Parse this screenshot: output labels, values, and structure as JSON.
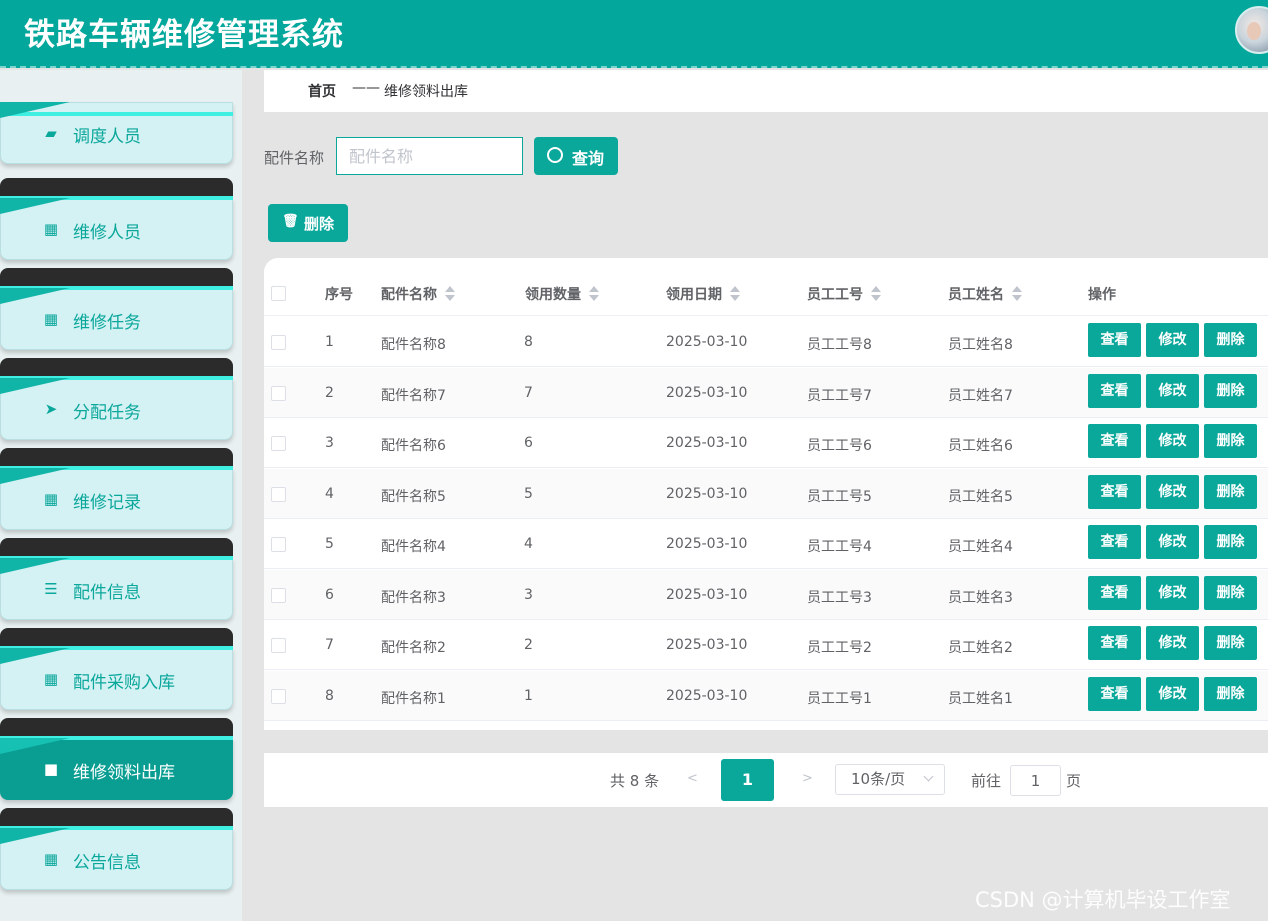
{
  "header": {
    "title": "铁路车辆维修管理系统"
  },
  "sidebar": {
    "items": [
      {
        "label": "调度人员",
        "icon": "wallet-icon",
        "glyph": "▰"
      },
      {
        "label": "维修人员",
        "icon": "grid-icon",
        "glyph": "▦"
      },
      {
        "label": "维修任务",
        "icon": "grid-icon",
        "glyph": "▦"
      },
      {
        "label": "分配任务",
        "icon": "paper-plane-icon",
        "glyph": "➤"
      },
      {
        "label": "维修记录",
        "icon": "grid-icon",
        "glyph": "▦"
      },
      {
        "label": "配件信息",
        "icon": "list-icon",
        "glyph": "☰"
      },
      {
        "label": "配件采购入库",
        "icon": "grid-icon",
        "glyph": "▦"
      },
      {
        "label": "维修领料出库",
        "icon": "briefcase-icon",
        "glyph": "■",
        "active": true
      },
      {
        "label": "公告信息",
        "icon": "table-icon",
        "glyph": "▦"
      }
    ]
  },
  "breadcrumb": {
    "home": "首页",
    "separator": "——",
    "current": "维修领料出库"
  },
  "search": {
    "label": "配件名称",
    "placeholder": "配件名称",
    "value": "",
    "button": "查询"
  },
  "toolbar": {
    "delete_label": "删除"
  },
  "table": {
    "columns": [
      "序号",
      "配件名称",
      "领用数量",
      "领用日期",
      "员工工号",
      "员工姓名",
      "操作"
    ],
    "rows": [
      [
        "1",
        "配件名称8",
        "8",
        "2025-03-10",
        "员工工号8",
        "员工姓名8"
      ],
      [
        "2",
        "配件名称7",
        "7",
        "2025-03-10",
        "员工工号7",
        "员工姓名7"
      ],
      [
        "3",
        "配件名称6",
        "6",
        "2025-03-10",
        "员工工号6",
        "员工姓名6"
      ],
      [
        "4",
        "配件名称5",
        "5",
        "2025-03-10",
        "员工工号5",
        "员工姓名5"
      ],
      [
        "5",
        "配件名称4",
        "4",
        "2025-03-10",
        "员工工号4",
        "员工姓名4"
      ],
      [
        "6",
        "配件名称3",
        "3",
        "2025-03-10",
        "员工工号3",
        "员工姓名3"
      ],
      [
        "7",
        "配件名称2",
        "2",
        "2025-03-10",
        "员工工号2",
        "员工姓名2"
      ],
      [
        "8",
        "配件名称1",
        "1",
        "2025-03-10",
        "员工工号1",
        "员工姓名1"
      ]
    ],
    "actions": [
      "查看",
      "修改",
      "删除"
    ]
  },
  "pagination": {
    "total": "共 8 条",
    "prev": "<",
    "current_page": "1",
    "next": ">",
    "page_size": "10条/页",
    "goto_label": "前往",
    "goto_value": "1",
    "goto_unit": "页"
  },
  "watermark": "CSDN @计算机毕设工作室",
  "colors": {
    "primary": "#04a79b",
    "sidebar_bg": "#e8f0f1",
    "menu_bg": "#d4f1f3",
    "menu_dark": "#2b2b2b",
    "accent_line": "#3ff0e2"
  }
}
